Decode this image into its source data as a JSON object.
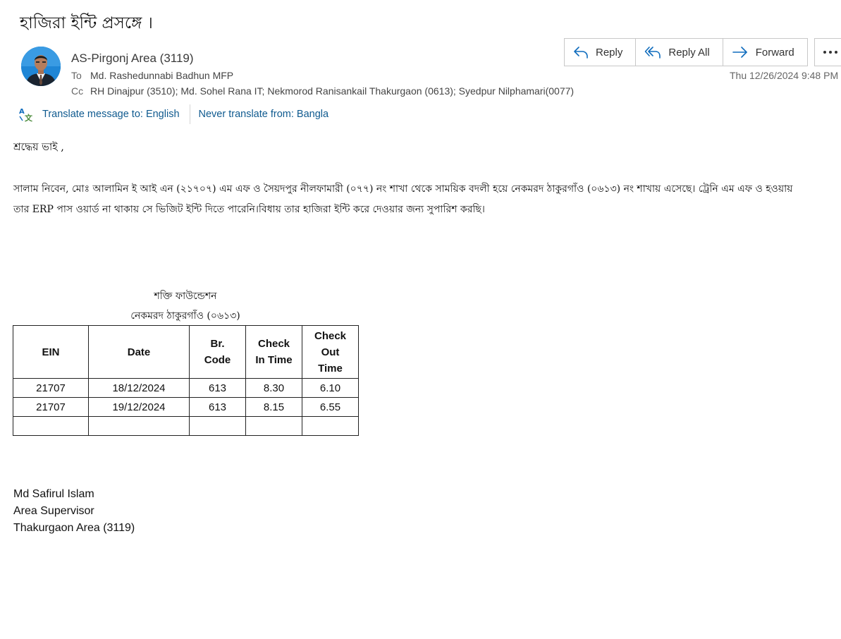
{
  "email": {
    "subject": "হাজিরা ইন্টি প্রসঙ্গে ।",
    "sender": "AS-Pirgonj Area (3119)",
    "to_label": "To",
    "to": "Md. Rashedunnabi Badhun MFP",
    "cc_label": "Cc",
    "cc": "RH Dinajpur (3510); Md. Sohel Rana IT; Nekmorod  Ranisankail Thakurgaon (0613); Syedpur Nilphamari(0077)",
    "timestamp": "Thu 12/26/2024 9:48 PM"
  },
  "actions": {
    "reply": "Reply",
    "reply_all": "Reply All",
    "forward": "Forward"
  },
  "translate": {
    "translate_to": "Translate message to: English",
    "never_translate": "Never translate from: Bangla"
  },
  "body": {
    "greeting": "শ্রদ্ধেয় ভাই ,",
    "line1": "সালাম নিবেন, মোঃ আলামিন  ই আই এন (২১৭০৭) এম এফ ও   সৈয়দপুর নীলফামারী (০৭৭) নং শাখা থেকে সাময়িক বদলী হয়ে নেকমরদ ঠাকুরগাঁও (০৬১৩) নং শাখায় এসেছে। ট্রেনি এম এফ ও  হওয়ায়",
    "line2": "তার  ERP পাস ওয়ার্ড না থাকায় সে ভিজিট ইন্টি দিতে পারেনি।বিধায় তার হাজিরা ইন্টি করে দেওয়ার জন্য সুপারিশ করছি।",
    "org_name": "শক্তি ফাউন্ডেশন",
    "branch_name": "নেকমরদ  ঠাকুরগাঁও (০৬১৩)"
  },
  "table": {
    "headers": [
      "EIN",
      "Date",
      "Br. Code",
      "Check In Time",
      "Check Out Time"
    ],
    "header_lines": [
      [
        "EIN"
      ],
      [
        "Date"
      ],
      [
        "Br.",
        "Code"
      ],
      [
        "Check",
        "In Time"
      ],
      [
        "Check",
        "Out",
        "Time"
      ]
    ],
    "rows": [
      [
        "21707",
        "18/12/2024",
        "613",
        "8.30",
        "6.10"
      ],
      [
        "21707",
        "19/12/2024",
        "613",
        "8.15",
        "6.55"
      ],
      [
        "",
        "",
        "",
        "",
        ""
      ]
    ]
  },
  "signature": {
    "name": "Md Safirul Islam",
    "title": "Area Supervisor",
    "area": "Thakurgaon Area (3119)"
  },
  "icons": {
    "reply": "reply-icon",
    "reply_all": "reply-all-icon",
    "forward": "forward-icon",
    "more": "more-icon",
    "translate": "translate-icon",
    "avatar": "avatar"
  },
  "colors": {
    "link": "#0f5a8f",
    "icon_accent": "#0f6cbd",
    "avatar_bg": "#1f86d6"
  }
}
